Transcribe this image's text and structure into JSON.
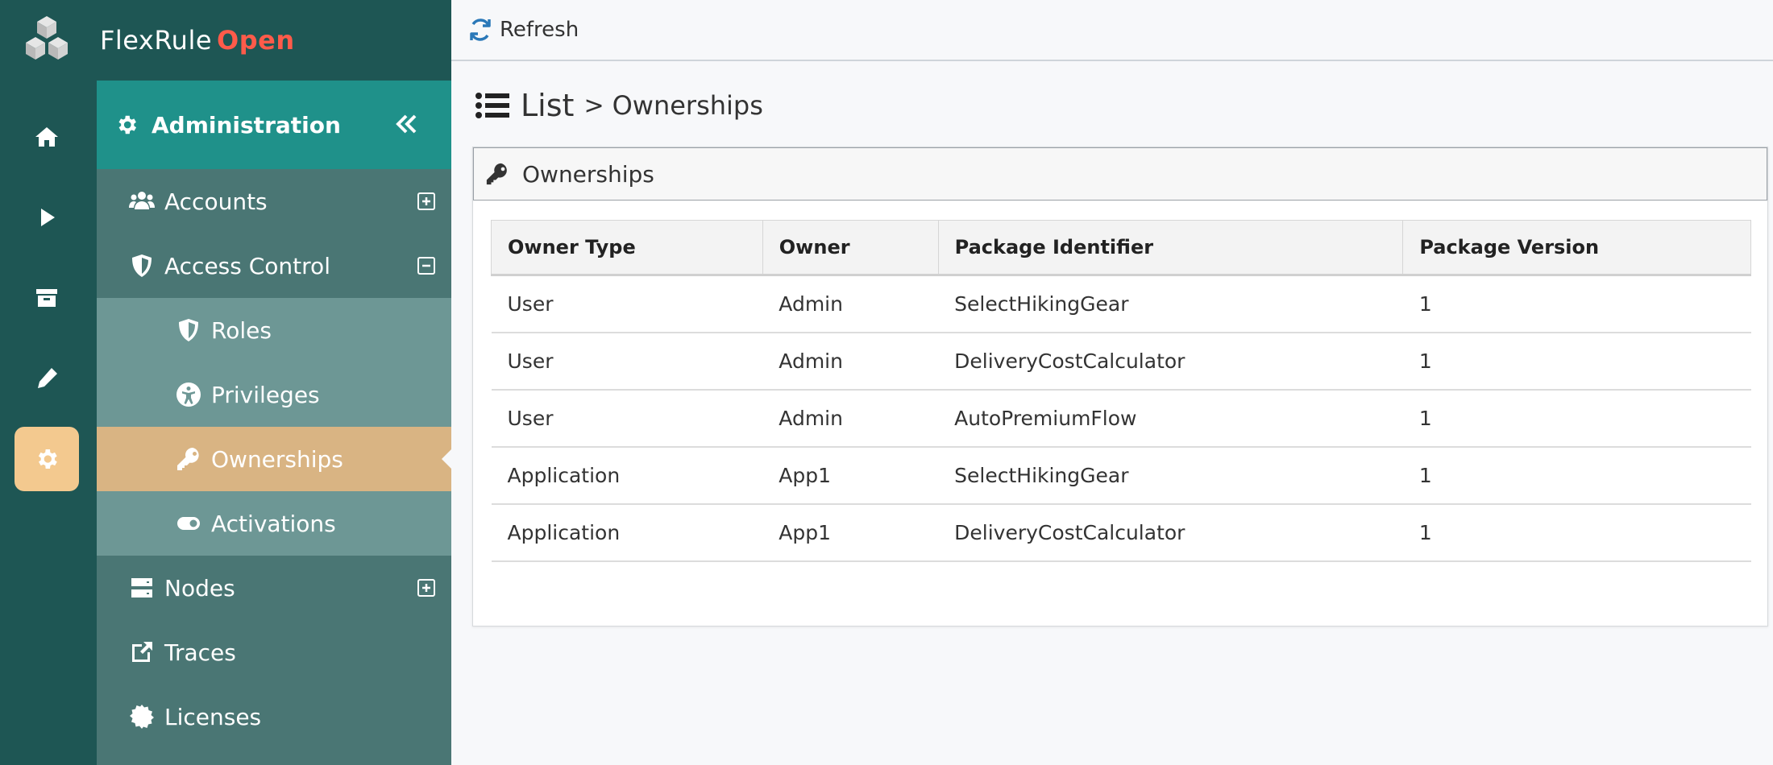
{
  "app": {
    "name": "FlexRule",
    "edition": "Open"
  },
  "rail": {
    "items": [
      {
        "name": "home",
        "icon": "home-icon"
      },
      {
        "name": "run",
        "icon": "play-icon"
      },
      {
        "name": "archive",
        "icon": "archive-icon"
      },
      {
        "name": "edit",
        "icon": "pencil-icon"
      },
      {
        "name": "administration",
        "icon": "gear-icon",
        "active": true
      }
    ]
  },
  "sidebar": {
    "title": "Administration",
    "items": [
      {
        "label": "Accounts",
        "icon": "users-icon",
        "toggle": "expand"
      },
      {
        "label": "Access Control",
        "icon": "shield-icon",
        "toggle": "collapse"
      },
      {
        "label": "Roles",
        "icon": "shield-icon",
        "sub": true
      },
      {
        "label": "Privileges",
        "icon": "accessibility-icon",
        "sub": true
      },
      {
        "label": "Ownerships",
        "icon": "key-icon",
        "sub": true,
        "selected": true
      },
      {
        "label": "Activations",
        "icon": "toggle-icon",
        "sub": true
      },
      {
        "label": "Nodes",
        "icon": "server-icon",
        "toggle": "expand"
      },
      {
        "label": "Traces",
        "icon": "external-link-icon"
      },
      {
        "label": "Licenses",
        "icon": "certificate-icon"
      }
    ]
  },
  "toolbar": {
    "refresh_label": "Refresh"
  },
  "breadcrumb": {
    "root": "List",
    "separator": ">",
    "current": "Ownerships"
  },
  "panel": {
    "title": "Ownerships"
  },
  "table": {
    "columns": [
      "Owner Type",
      "Owner",
      "Package Identifier",
      "Package Version"
    ],
    "rows": [
      [
        "User",
        "Admin",
        "SelectHikingGear",
        "1"
      ],
      [
        "User",
        "Admin",
        "DeliveryCostCalculator",
        "1"
      ],
      [
        "User",
        "Admin",
        "AutoPremiumFlow",
        "1"
      ],
      [
        "Application",
        "App1",
        "SelectHikingGear",
        "1"
      ],
      [
        "Application",
        "App1",
        "DeliveryCostCalculator",
        "1"
      ]
    ]
  },
  "colors": {
    "rail": "#1e5654",
    "sidebar": "#4a7674",
    "sidebar_header": "#1f918a",
    "submenu": "#6d9795",
    "selected": "#d9b483",
    "rail_active": "#f3c98f",
    "brand_accent": "#ff5b4a",
    "refresh_icon": "#2a78b8"
  }
}
